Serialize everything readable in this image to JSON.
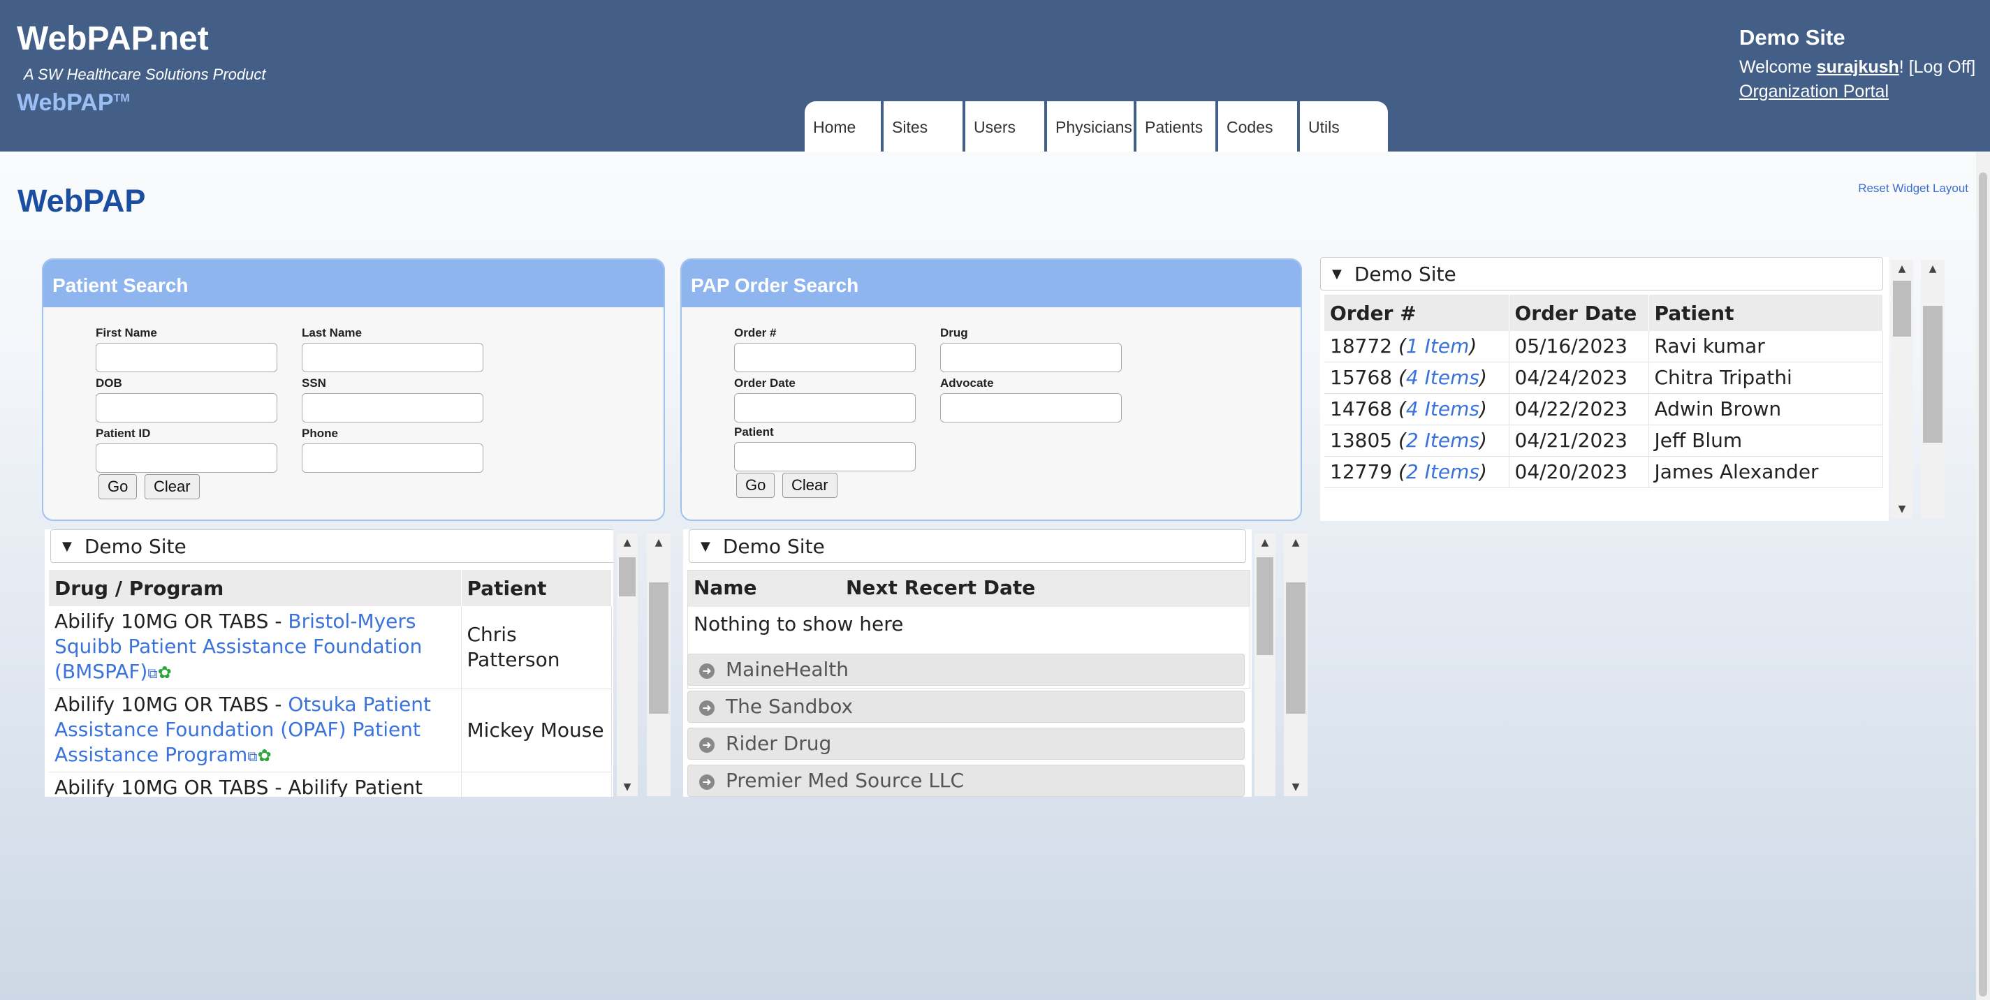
{
  "header": {
    "brand": "WebPAP.net",
    "tagline": "A SW Healthcare Solutions Product",
    "logo_text": "WebPAP",
    "logo_tm": "TM",
    "nav": [
      "Home",
      "Sites",
      "Users",
      "Physicians",
      "Patients",
      "Codes",
      "Utils"
    ],
    "site_name": "Demo Site",
    "welcome_prefix": "Welcome ",
    "username": "surajkush",
    "welcome_suffix": "! ",
    "logoff": "[Log Off]",
    "org_portal": "Organization Portal"
  },
  "page": {
    "title": "WebPAP",
    "reset_layout": "Reset Widget Layout"
  },
  "patient_search": {
    "title": "Patient Search",
    "labels": {
      "first_name": "First Name",
      "last_name": "Last Name",
      "dob": "DOB",
      "ssn": "SSN",
      "patient_id": "Patient ID",
      "phone": "Phone"
    },
    "values": {
      "first_name": "",
      "last_name": "",
      "dob": "",
      "ssn": "",
      "patient_id": "",
      "phone": ""
    },
    "go": "Go",
    "clear": "Clear"
  },
  "order_search": {
    "title": "PAP Order Search",
    "labels": {
      "order_no": "Order #",
      "drug": "Drug",
      "order_date": "Order Date",
      "advocate": "Advocate",
      "patient": "Patient"
    },
    "values": {
      "order_no": "",
      "drug": "",
      "order_date": "",
      "advocate": "",
      "patient": ""
    },
    "go": "Go",
    "clear": "Clear"
  },
  "orders_widget": {
    "site": "Demo Site",
    "columns": [
      "Order #",
      "Order Date",
      "Patient"
    ],
    "rows": [
      {
        "order": "18772",
        "items": "1 Item",
        "date": "05/16/2023",
        "patient": "Ravi kumar"
      },
      {
        "order": "15768",
        "items": "4 Items",
        "date": "04/24/2023",
        "patient": "Chitra Tripathi"
      },
      {
        "order": "14768",
        "items": "4 Items",
        "date": "04/22/2023",
        "patient": "Adwin Brown"
      },
      {
        "order": "13805",
        "items": "2 Items",
        "date": "04/21/2023",
        "patient": "Jeff Blum"
      },
      {
        "order": "12779",
        "items": "2 Items",
        "date": "04/20/2023",
        "patient": "James Alexander"
      }
    ]
  },
  "drugs_widget": {
    "site": "Demo Site",
    "columns": [
      "Drug / Program",
      "Patient"
    ],
    "rows": [
      {
        "drug": "Abilify 10MG OR TABS - ",
        "program": "Bristol-Myers Squibb Patient Assistance Foundation (BMSPAF)",
        "patient": "Chris Patterson"
      },
      {
        "drug": "Abilify 10MG OR TABS - ",
        "program": "Otsuka Patient Assistance Foundation (OPAF) Patient Assistance Program",
        "patient": "Mickey Mouse"
      },
      {
        "drug": "Abilify 10MG OR TABS - Abilify Patient",
        "program": "",
        "patient": ""
      }
    ]
  },
  "recert_widget": {
    "site": "Demo Site",
    "columns": [
      "Name",
      "Next Recert Date"
    ],
    "empty": "Nothing to show here",
    "groups": [
      "MaineHealth",
      "The Sandbox",
      "Rider Drug",
      "Premier Med Source LLC"
    ]
  }
}
